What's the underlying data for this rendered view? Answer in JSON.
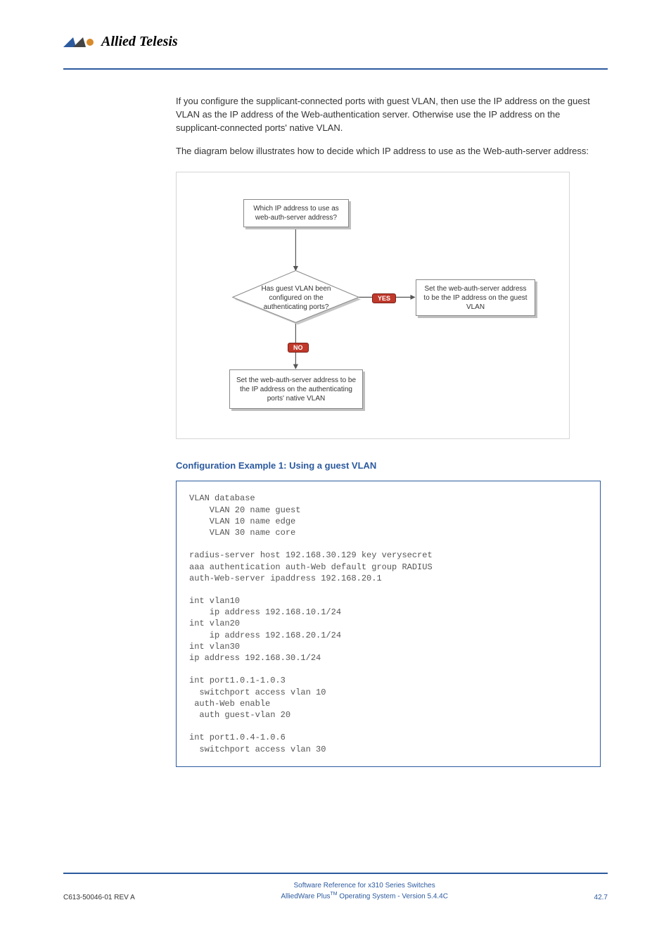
{
  "brand": {
    "name": "Allied Telesis"
  },
  "paragraphs": {
    "p1": "If you configure the supplicant-connected ports with guest VLAN, then use the IP address on the guest VLAN as the IP address of the Web-authentication server. Otherwise use the IP address on the supplicant-connected ports' native VLAN.",
    "p2": "The diagram below illustrates how to decide which IP address to use as the Web-auth-server address:"
  },
  "diagram": {
    "start": "Which IP address to use as web-auth-server address?",
    "decision": "Has guest VLAN been configured on the authenticating ports?",
    "yes_label": "YES",
    "no_label": "NO",
    "result_yes": "Set the web-auth-server address to be the IP address on the guest VLAN",
    "result_no": "Set the web-auth-server address to be the IP address on the authenticating ports' native VLAN"
  },
  "example_title": "Configuration Example 1: Using a guest VLAN",
  "code": "VLAN database\n    VLAN 20 name guest\n    VLAN 10 name edge\n    VLAN 30 name core\n\nradius-server host 192.168.30.129 key verysecret\naaa authentication auth-Web default group RADIUS\nauth-Web-server ipaddress 192.168.20.1\n\nint vlan10\n    ip address 192.168.10.1/24\nint vlan20\n    ip address 192.168.20.1/24\nint vlan30\nip address 192.168.30.1/24\n\nint port1.0.1-1.0.3\n  switchport access vlan 10\n auth-Web enable\n  auth guest-vlan 20\n\nint port1.0.4-1.0.6\n  switchport access vlan 30",
  "footer": {
    "left": "C613-50046-01 REV A",
    "line1": "Software Reference for x310 Series Switches",
    "line2_pre": "AlliedWare Plus",
    "line2_sup": "TM",
    "line2_post": " Operating System - Version 5.4.4C",
    "right": "42.7"
  }
}
